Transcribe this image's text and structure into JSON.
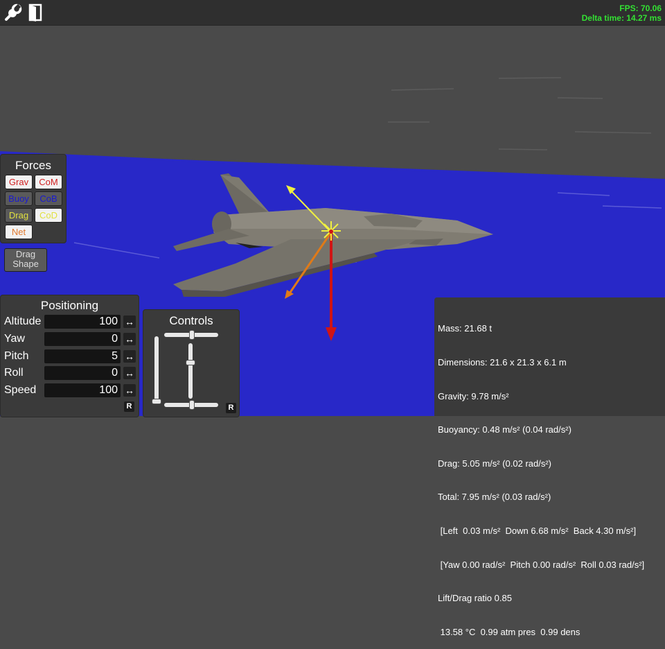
{
  "fps": {
    "fps_text": "FPS: 70.06",
    "delta_text": "Delta time: 14.27 ms"
  },
  "toolbar": {
    "settings_icon": "wrench-icon",
    "exit_icon": "exit-door-icon"
  },
  "colors": {
    "sky": "#4a4a4a",
    "water": "#2828c8",
    "panel": "#3a3a3a",
    "fps_green": "#33e033",
    "gravity_arrow": "#d01414",
    "lift_arrow": "#f0f040",
    "drag_arrow": "#e07a18"
  },
  "forces": {
    "title": "Forces",
    "buttons": [
      {
        "label": "Grav",
        "color": "#d02020",
        "active": true
      },
      {
        "label": "CoM",
        "color": "#d02020",
        "active": true
      },
      {
        "label": "Buoy",
        "color": "#1a1ad0",
        "active": false
      },
      {
        "label": "CoB",
        "color": "#1a1ad0",
        "active": false
      },
      {
        "label": "Drag",
        "color": "#e0e040",
        "active": false
      },
      {
        "label": "CoD",
        "color": "#e0e040",
        "active": true
      },
      {
        "label": "Net",
        "color": "#e07a30",
        "active": true
      }
    ],
    "drag_shape_line1": "Drag",
    "drag_shape_line2": "Shape"
  },
  "positioning": {
    "title": "Positioning",
    "rows": [
      {
        "label": "Altitude",
        "value": "100",
        "arrow": "↔"
      },
      {
        "label": "Yaw",
        "value": "0",
        "arrow": "↔"
      },
      {
        "label": "Pitch",
        "value": "5",
        "arrow": "↔"
      },
      {
        "label": "Roll",
        "value": "0",
        "arrow": "↔"
      },
      {
        "label": "Speed",
        "value": "100",
        "arrow": "↔"
      }
    ],
    "reset_label": "R"
  },
  "controls": {
    "title": "Controls",
    "reset_label": "R",
    "throttle": 0.0,
    "elevator": 0.35,
    "aileron": 0.5,
    "rudder": 0.5
  },
  "info": {
    "lines": [
      "Mass: 21.68 t",
      "Dimensions: 21.6 x 21.3 x 6.1 m",
      "Gravity: 9.78 m/s²",
      "Buoyancy: 0.48 m/s² (0.04 rad/s²)",
      "Drag: 5.05 m/s² (0.02 rad/s²)",
      "Total: 7.95 m/s² (0.03 rad/s²)",
      " [Left  0.03 m/s²  Down 6.68 m/s²  Back 4.30 m/s²]",
      " [Yaw 0.00 rad/s²  Pitch 0.00 rad/s²  Roll 0.03 rad/s²]",
      "Lift/Drag ratio 0.85",
      " 13.58 °C  0.99 atm pres  0.99 dens"
    ]
  }
}
